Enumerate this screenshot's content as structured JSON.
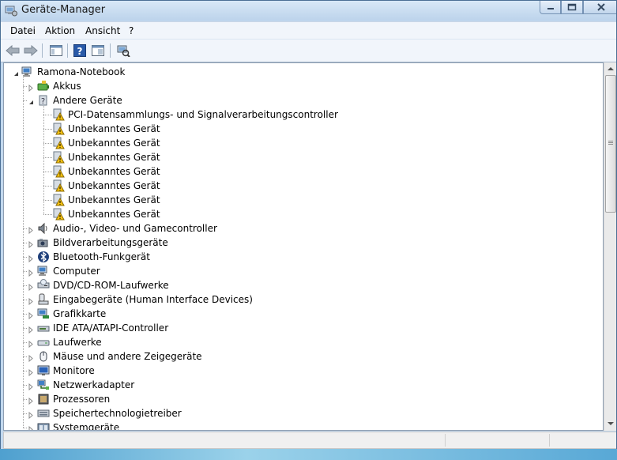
{
  "window": {
    "title": "Geräte-Manager"
  },
  "menu": [
    "Datei",
    "Aktion",
    "Ansicht",
    "?"
  ],
  "tree": {
    "root": "Ramona-Notebook",
    "items": [
      {
        "label": "Akkus"
      },
      {
        "label": "Andere Geräte",
        "children": [
          "PCI-Datensammlungs- und Signalverarbeitungscontroller",
          "Unbekanntes Gerät",
          "Unbekanntes Gerät",
          "Unbekanntes Gerät",
          "Unbekanntes Gerät",
          "Unbekanntes Gerät",
          "Unbekanntes Gerät",
          "Unbekanntes Gerät"
        ]
      },
      {
        "label": "Audio-, Video- und Gamecontroller"
      },
      {
        "label": "Bildverarbeitungsgeräte"
      },
      {
        "label": "Bluetooth-Funkgerät"
      },
      {
        "label": "Computer"
      },
      {
        "label": "DVD/CD-ROM-Laufwerke"
      },
      {
        "label": "Eingabegeräte (Human Interface Devices)"
      },
      {
        "label": "Grafikkarte"
      },
      {
        "label": "IDE ATA/ATAPI-Controller"
      },
      {
        "label": "Laufwerke"
      },
      {
        "label": "Mäuse und andere Zeigegeräte"
      },
      {
        "label": "Monitore"
      },
      {
        "label": "Netzwerkadapter"
      },
      {
        "label": "Prozessoren"
      },
      {
        "label": "Speichertechnologietreiber"
      },
      {
        "label": "Systemgeräte"
      }
    ]
  },
  "icons": {
    "root": "computer-icon",
    "categories": [
      "battery-icon",
      "unknown-device-icon",
      "speaker-icon",
      "camera-icon",
      "bluetooth-icon",
      "computer-icon",
      "dvd-drive-icon",
      "hid-icon",
      "display-adapter-icon",
      "ide-controller-icon",
      "disk-drive-icon",
      "mouse-icon",
      "monitor-icon",
      "network-adapter-icon",
      "processor-icon",
      "storage-driver-icon",
      "system-devices-icon"
    ],
    "child": "warning-device-icon"
  },
  "colors": {
    "titlebar": "#c2d8ee",
    "warning": "#f5c211",
    "window_bg": "#ffffff"
  }
}
